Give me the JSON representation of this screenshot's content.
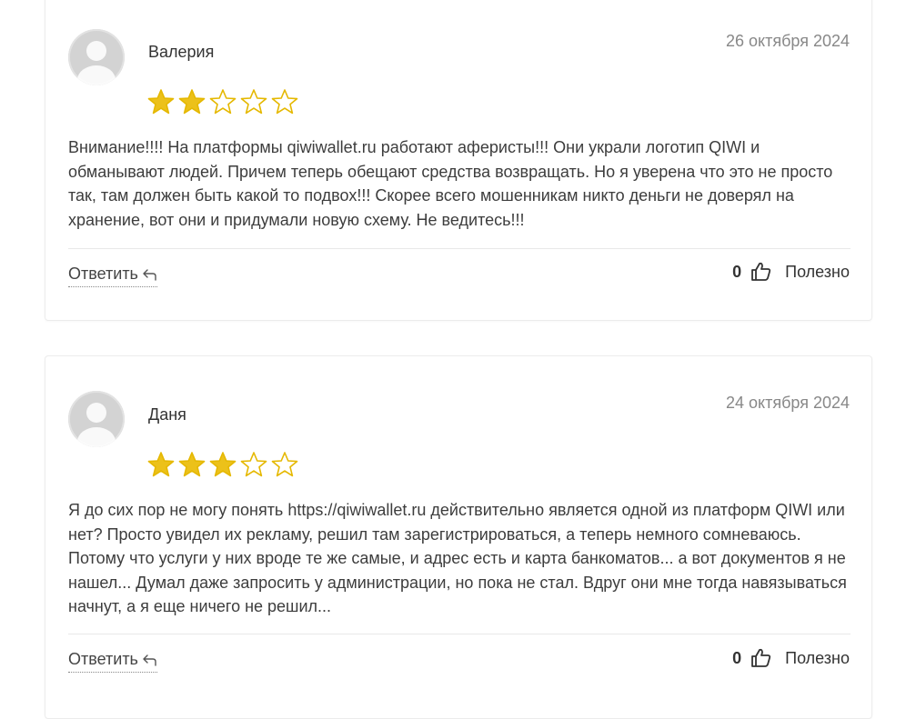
{
  "reviews": [
    {
      "author": "Валерия",
      "date": "26 октября 2024",
      "rating": 2,
      "max_rating": 5,
      "text": "Внимание!!!! На платформы qiwiwallet.ru работают аферисты!!! Они украли логотип QIWI и обманывают людей. Причем теперь обещают средства возвращать. Но я уверена что это не просто так, там должен быть какой то подвох!!! Скорее всего мошенникам никто деньги не доверял на хранение, вот они и придумали новую схему. Не ведитесь!!!",
      "reply_label": "Ответить",
      "helpful_count": "0",
      "helpful_label": "Полезно"
    },
    {
      "author": "Даня",
      "date": "24 октября 2024",
      "rating": 3,
      "max_rating": 5,
      "text": "Я до сих пор не могу понять https://qiwiwallet.ru действительно является одной из платформ QIWI или нет? Просто увидел их рекламу, решил там зарегистрироваться, а теперь немного сомневаюсь. Потому что услуги у них вроде те же самые, и адрес есть и карта банкоматов... а вот документов я не нашел... Думал даже запросить у администрации, но пока не стал. Вдруг они мне тогда навязываться начнут, а я еще ничего не решил...",
      "reply_label": "Ответить",
      "helpful_count": "0",
      "helpful_label": "Полезно"
    }
  ],
  "colors": {
    "star_fill": "#ecc11a",
    "star_outline": "#e5b800",
    "date_text": "#888888",
    "avatar_bg": "#d3d3d3"
  },
  "icons": {
    "avatar": "user-placeholder-icon",
    "star": "star-icon",
    "reply": "reply-arrow-icon",
    "helpful": "thumbs-up-icon"
  }
}
